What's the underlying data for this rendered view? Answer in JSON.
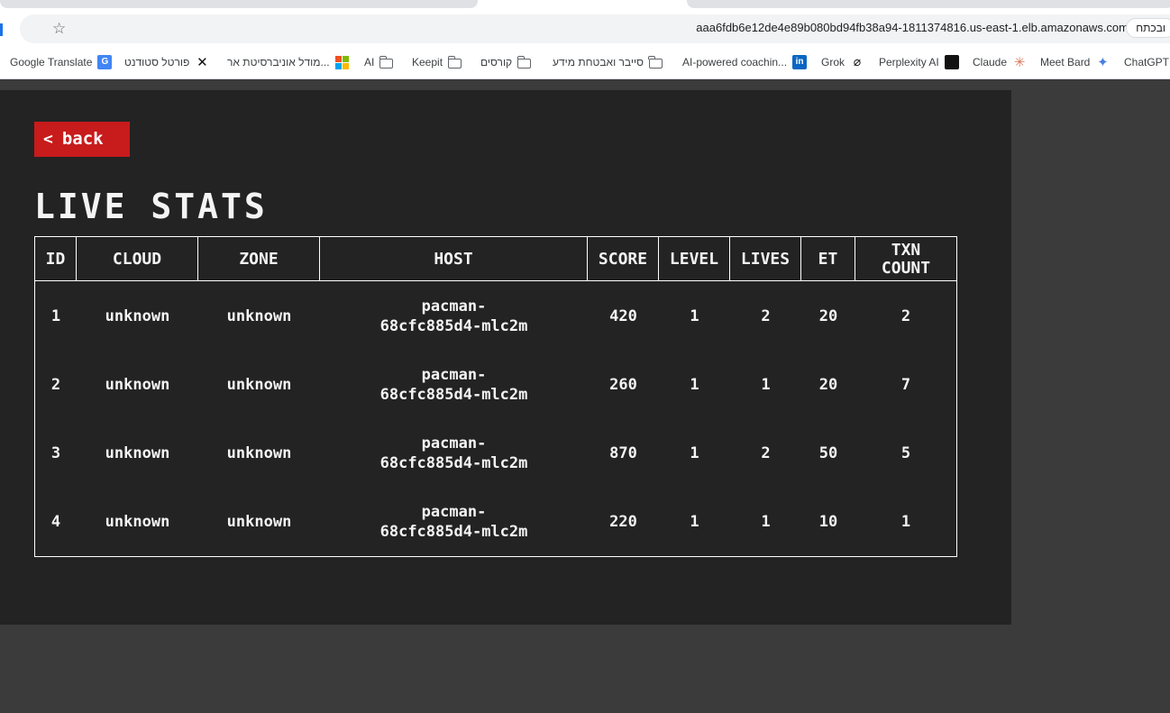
{
  "browser": {
    "url": "aaa6fdb6e12de4e89b080bd94fb38a94-1811374816.us-east-1.elb.amazonaws.com",
    "action_chip": "ובכתח",
    "bookmarks": [
      {
        "label": "Google Translate",
        "icon": "google-translate-icon"
      },
      {
        "label": "פורטל סטודנט",
        "icon": "x-logo-icon"
      },
      {
        "label": "מודל אוניברסיטת אר...",
        "icon": "microsoft-icon"
      },
      {
        "label": "AI",
        "icon": "folder-icon"
      },
      {
        "label": "Keepit",
        "icon": "folder-icon"
      },
      {
        "label": "קורסים",
        "icon": "folder-icon"
      },
      {
        "label": "סייבר ואבטחת מידע",
        "icon": "folder-icon"
      },
      {
        "label": "AI-powered coachin...",
        "icon": "linkedin-icon"
      },
      {
        "label": "Grok",
        "icon": "grok-icon"
      },
      {
        "label": "Perplexity AI",
        "icon": "perplexity-icon"
      },
      {
        "label": "Claude",
        "icon": "claude-icon"
      },
      {
        "label": "Meet Bard",
        "icon": "bard-icon"
      },
      {
        "label": "ChatGPT",
        "icon": ""
      }
    ]
  },
  "page": {
    "back_label": "back",
    "title": "LIVE STATS",
    "table": {
      "headers": [
        "ID",
        "CLOUD",
        "ZONE",
        "HOST",
        "SCORE",
        "LEVEL",
        "LIVES",
        "ET",
        "TXN COUNT"
      ],
      "rows": [
        {
          "id": "1",
          "cloud": "unknown",
          "zone": "unknown",
          "host_line1": "pacman-",
          "host_line2": "68cfc885d4-mlc2m",
          "score": "420",
          "level": "1",
          "lives": "2",
          "et": "20",
          "txn": "2"
        },
        {
          "id": "2",
          "cloud": "unknown",
          "zone": "unknown",
          "host_line1": "pacman-",
          "host_line2": "68cfc885d4-mlc2m",
          "score": "260",
          "level": "1",
          "lives": "1",
          "et": "20",
          "txn": "7"
        },
        {
          "id": "3",
          "cloud": "unknown",
          "zone": "unknown",
          "host_line1": "pacman-",
          "host_line2": "68cfc885d4-mlc2m",
          "score": "870",
          "level": "1",
          "lives": "2",
          "et": "50",
          "txn": "5"
        },
        {
          "id": "4",
          "cloud": "unknown",
          "zone": "unknown",
          "host_line1": "pacman-",
          "host_line2": "68cfc885d4-mlc2m",
          "score": "220",
          "level": "1",
          "lives": "1",
          "et": "10",
          "txn": "1"
        }
      ]
    }
  },
  "colors": {
    "back_button": "#c81b1b",
    "panel": "#232323",
    "page_background": "#3b3b3b",
    "text": "#f4f4f4"
  }
}
